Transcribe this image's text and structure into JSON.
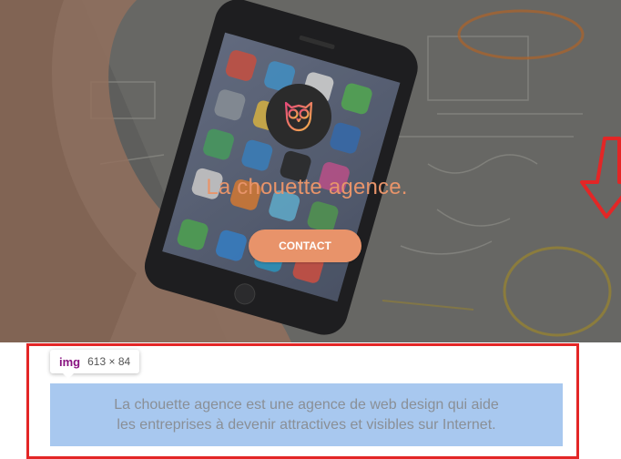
{
  "hero": {
    "title": "La chouette agence.",
    "contact_label": "CONTACT",
    "logo_icon": "owl-icon",
    "title_color": "#e8946a",
    "button_color": "#e8936a",
    "logo_bg": "#2b2b2b"
  },
  "inspector": {
    "tag": "img",
    "size": "613 × 84",
    "highlight_color": "#a8c8ef",
    "frame_color": "#e32626"
  },
  "description": {
    "line1": "La chouette agence est une agence de web design qui aide",
    "line2": "les entreprises à devenir attractives et visibles sur Internet."
  },
  "annotation": {
    "arrow_icon": "red-down-arrow-icon"
  }
}
